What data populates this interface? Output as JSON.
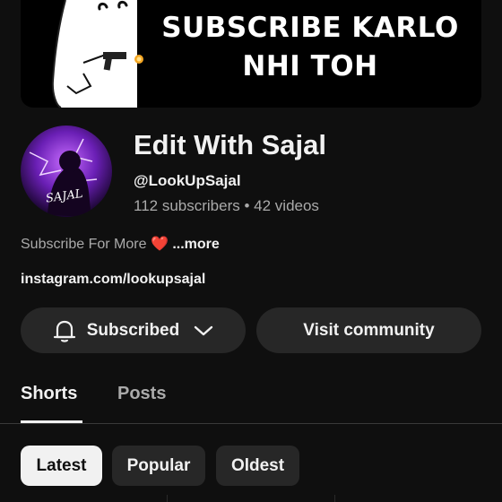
{
  "banner": {
    "line1": "SUBSCRIBE KARLO",
    "line2": "NHI TOH"
  },
  "channel": {
    "name": "Edit With Sajal",
    "handle": "@LookUpSajal",
    "subscribers": "112 subscribers",
    "separator": " • ",
    "videos": "42 videos",
    "avatar_text": "SAJAL",
    "description": "Subscribe For More",
    "description_emoji": "❤️",
    "more_label": "...more",
    "link": "instagram.com/lookupsajal"
  },
  "actions": {
    "subscribed_label": "Subscribed",
    "visit_community_label": "Visit community"
  },
  "tabs": [
    {
      "label": "Shorts",
      "selected": true
    },
    {
      "label": "Posts",
      "selected": false
    }
  ],
  "sort_chips": [
    {
      "label": "Latest",
      "selected": true
    },
    {
      "label": "Popular",
      "selected": false
    },
    {
      "label": "Oldest",
      "selected": false
    }
  ],
  "colors": {
    "background": "#0f0f0f",
    "surface": "#272727",
    "text_primary": "#f1f1f1",
    "text_secondary": "#aaaaaa",
    "heart": "#e53935"
  }
}
